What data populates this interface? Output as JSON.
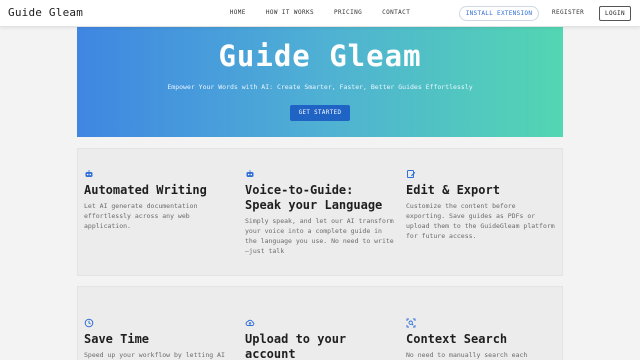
{
  "header": {
    "brand": "Guide Gleam",
    "nav": [
      "HOME",
      "HOW IT WORKS",
      "PRICING",
      "CONTACT"
    ],
    "install_label": "INSTALL EXTENSION",
    "register_label": "REGISTER",
    "login_label": "LOGIN"
  },
  "hero": {
    "title": "Guide Gleam",
    "subtitle": "Empower Your Words with AI: Create Smarter, Faster, Better Guides Effortlessly",
    "cta": "GET STARTED"
  },
  "features_row1": [
    {
      "icon": "robot-icon",
      "title": "Automated Writing",
      "desc": "Let AI generate documentation effortlessly across any web application."
    },
    {
      "icon": "robot-icon",
      "title": "Voice-to-Guide: Speak your Language",
      "desc": "Simply speak, and let our AI transform your voice into a complete guide in the language you use. No need to write—just talk"
    },
    {
      "icon": "edit-icon",
      "title": "Edit & Export",
      "desc": "Customize the content before exporting. Save guides as PDFs or upload them to the GuideGleam platform for future access."
    }
  ],
  "features_row2": [
    {
      "icon": "clock-icon",
      "title": "Save Time",
      "desc": "Speed up your workflow by letting AI handle repetitive documentation"
    },
    {
      "icon": "cloud-upload-icon",
      "title": "Upload to your account",
      "desc": ""
    },
    {
      "icon": "scan-search-icon",
      "title": "Context Search",
      "desc": "No need to manually search each document for a specific action; the"
    }
  ],
  "colors": {
    "accent": "#1f63c4",
    "icon": "#2f6fd6",
    "hero_start": "#3f86e2",
    "hero_end": "#53d6b2"
  }
}
